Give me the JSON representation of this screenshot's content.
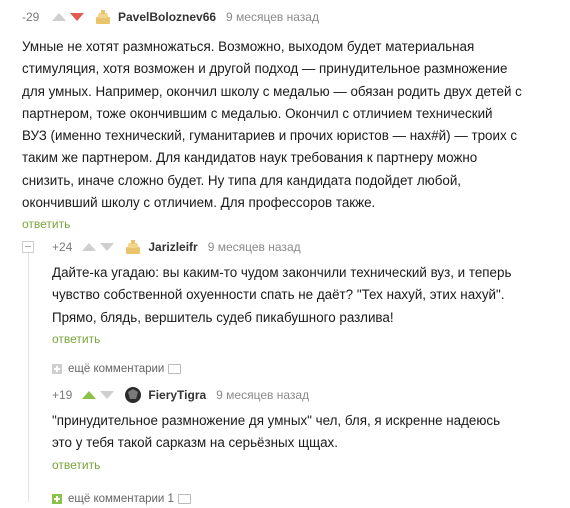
{
  "comments": [
    {
      "rating": "-29",
      "author": "PavelBoloznev66",
      "time": "9 месяцев назад",
      "text": "Умные не хотят размножаться. Возможно, выходом будет материальная\nстимуляция, хотя возможен и другой подход — принудительное размножение\nдля умных. Например, окончил школу с медалью — обязан родить двух детей с\nпартнером, тоже окончившим с медалью. Окончил с отличием технический\nВУЗ (именно технический, гуманитариев и прочих юристов — нах#й) — троих с\nтаким же партнером. Для кандидатов наук требования к партнеру можно\nснизить, иначе сложно будет. Ну типа для кандидата подойдет любой,\nокончивший школу с отличием. Для профессоров также.",
      "reply_label": "ответить"
    },
    {
      "rating": "+24",
      "author": "Jarizleifr",
      "time": "9 месяцев назад",
      "text": "Дайте-ка угадаю: вы каким-то чудом закончили технический вуз, и теперь\nчувство собственной охуенности спать не даёт? \"Тех нахуй, этих нахуй\".\nПрямо, блядь, вершитель судеб пикабушного разлива!",
      "reply_label": "ответить"
    },
    {
      "rating": "+19",
      "author": "FieryTigra",
      "time": "9 месяцев назад",
      "text": "\"принудительное размножение дя умных\" чел, бля, я искренне надеюсь\nэто у тебя такой сарказм на серьёзных щщах.",
      "reply_label": "ответить"
    }
  ],
  "more_comments": {
    "label": "ещё комментарии"
  },
  "more_comments_bottom": {
    "label": "ещё комментарии 1"
  },
  "colors": {
    "upvote": "#8bc34a",
    "downvote": "#e05a4f",
    "reply": "#7aa33b"
  }
}
